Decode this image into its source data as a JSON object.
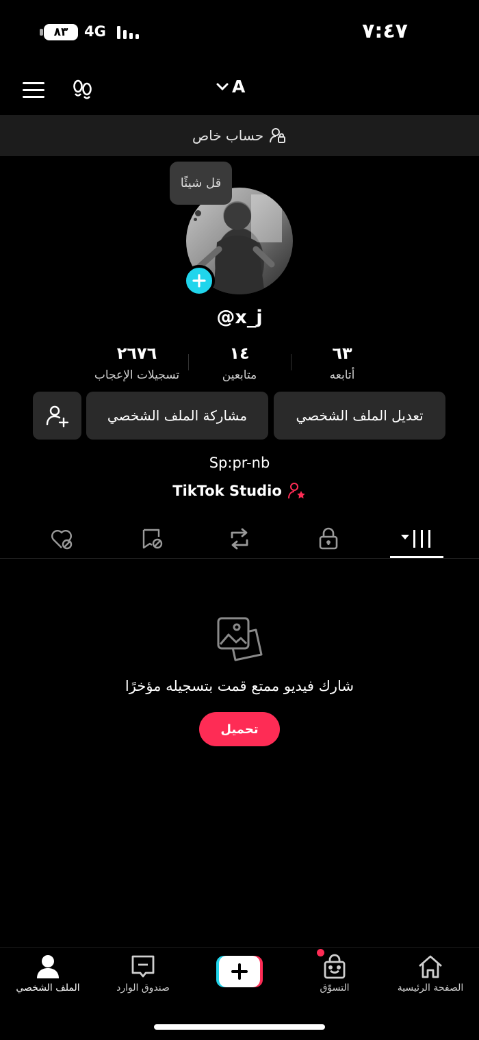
{
  "status_bar": {
    "battery": "٨٣",
    "network": "4G",
    "time": "٧:٤٧"
  },
  "top_nav": {
    "account_name": "A"
  },
  "private_banner": {
    "label": "حساب خاص"
  },
  "profile": {
    "bubble_text": "قل شيئًا",
    "handle": "@x_j",
    "stats": {
      "following": {
        "value": "٦٣",
        "label": "أتابعه"
      },
      "followers": {
        "value": "١٤",
        "label": "متابعين"
      },
      "likes": {
        "value": "٢٦٧٦",
        "label": "تسجيلات الإعجاب"
      }
    },
    "buttons": {
      "edit": "تعديل الملف الشخصي",
      "share": "مشاركة الملف الشخصي"
    },
    "bio": "Sp:pr-nb",
    "studio_link": "TikTok Studio"
  },
  "empty_state": {
    "message": "شارك فيديو ممتع قمت بتسجيله مؤخرًا",
    "button": "تحميل"
  },
  "bottom_nav": {
    "home": "الصفحة الرئيسية",
    "shop": "التسوّق",
    "inbox": "صندوق الوارد",
    "profile": "الملف الشخصي"
  },
  "colors": {
    "accent_red": "#fe2c55",
    "accent_cyan": "#20d5ec",
    "background": "#000000",
    "button_bg": "#2a2a2a"
  }
}
